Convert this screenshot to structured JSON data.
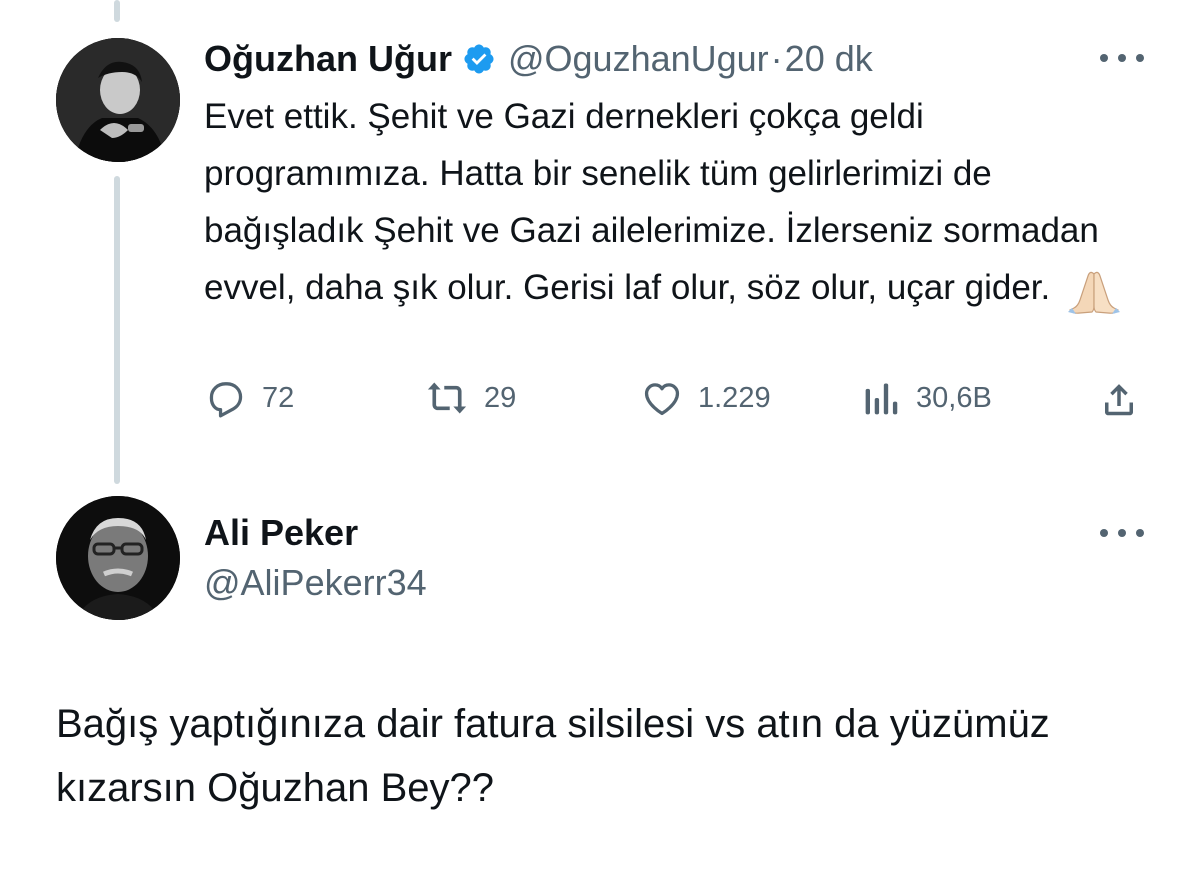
{
  "tweet1": {
    "display_name": "Oğuzhan Uğur",
    "handle": "@OguzhanUgur",
    "separator": "·",
    "time": "20 dk",
    "text": "Evet ettik. Şehit ve Gazi dernekleri çokça geldi programımıza. Hatta bir senelik tüm gelirlerimizi de bağışladık Şehit ve Gazi ailelerimize. İzlerseniz sormadan evvel, daha şık olur. Gerisi laf olur, söz olur, uçar gider.",
    "emoji": "folded-hands",
    "verified": true,
    "actions": {
      "replies": "72",
      "retweets": "29",
      "likes": "1.229",
      "views": "30,6B"
    }
  },
  "tweet2": {
    "display_name": "Ali Peker",
    "handle": "@AliPekerr34",
    "text": "Bağış yaptığınıza dair fatura silsilesi vs atın da yüzümüz kızarsın Oğuzhan Bey??"
  },
  "colors": {
    "text": "#0f1419",
    "secondary": "#536471",
    "thread_line": "#cfd9de",
    "verified": "#1d9bf0"
  }
}
